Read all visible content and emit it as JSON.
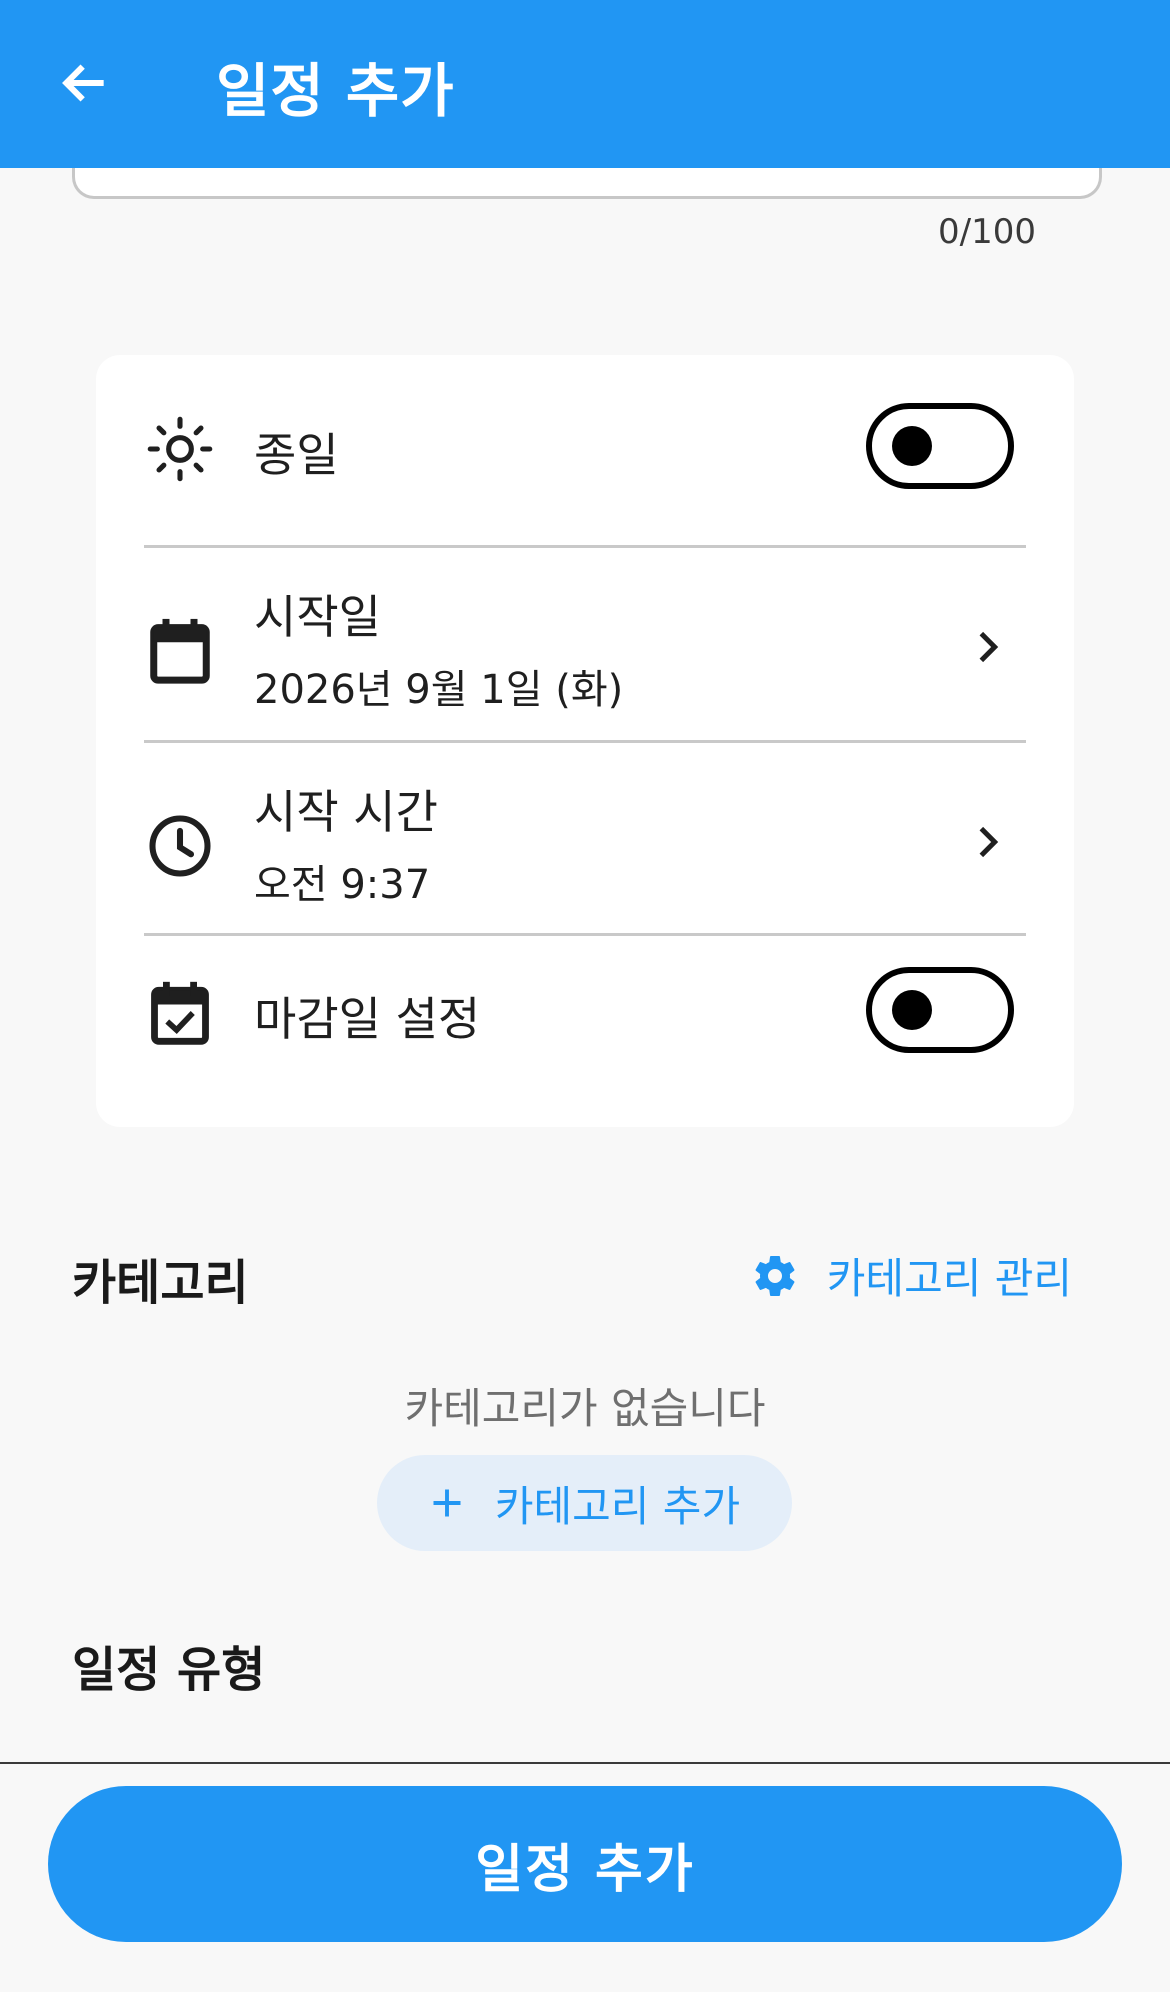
{
  "appbar": {
    "title": "일정 추가",
    "back_icon": "arrow-left-icon"
  },
  "title_field": {
    "counter": "0/100"
  },
  "settings": {
    "all_day": {
      "label": "종일",
      "icon": "sun-icon",
      "on": false
    },
    "start_date": {
      "label": "시작일",
      "value": "2026년 9월 1일 (화)",
      "icon": "calendar-icon"
    },
    "start_time": {
      "label": "시작 시간",
      "value": "오전 9:37",
      "icon": "clock-icon"
    },
    "deadline": {
      "label": "마감일 설정",
      "icon": "calendar-check-icon",
      "on": false
    }
  },
  "category": {
    "heading": "카테고리",
    "manage_label": "카테고리 관리",
    "empty_message": "카테고리가 없습니다",
    "add_label": "카테고리 추가"
  },
  "schedule_type": {
    "heading": "일정 유형"
  },
  "submit_label": "일정 추가",
  "colors": {
    "primary": "#2196f3",
    "background": "#f8f8f8"
  }
}
